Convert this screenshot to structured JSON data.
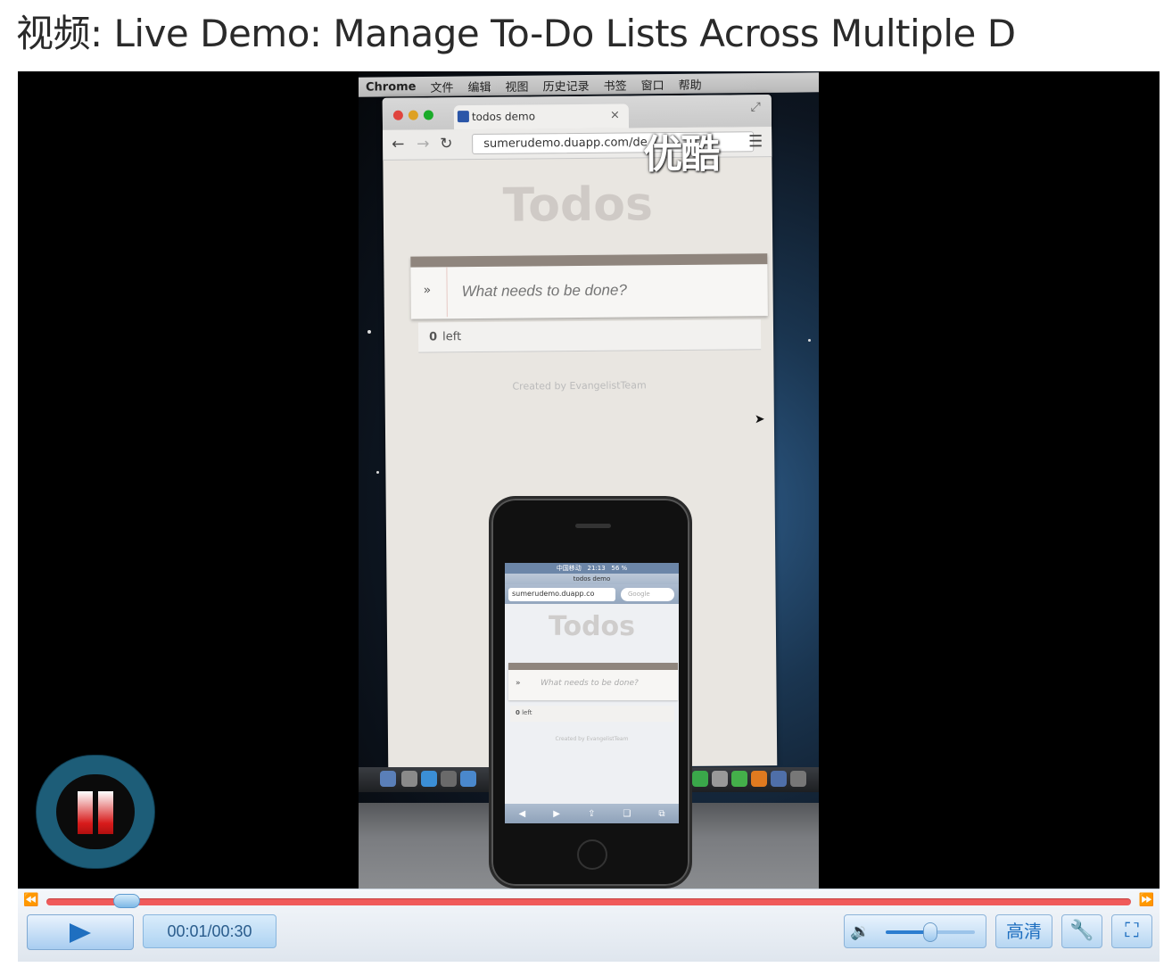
{
  "page": {
    "title": "视频: Live Demo: Manage To-Do Lists Across Multiple D"
  },
  "video": {
    "mac_menubar": [
      "Chrome",
      "文件",
      "编辑",
      "视图",
      "历史记录",
      "书签",
      "窗口",
      "帮助"
    ],
    "browser": {
      "tab_title": "todos demo",
      "tab_close": "×",
      "url": "sumerudemo.duapp.com/de",
      "watermark": "优酷"
    },
    "todos_app": {
      "title": "Todos",
      "toggle_all": "»",
      "input_placeholder": "What needs to be done?",
      "count": "0",
      "count_label": "left",
      "credit": "Created by EvangelistTeam"
    },
    "iphone": {
      "status_time": "21:13",
      "status_carrier": "中国移动",
      "status_battery": "56 %",
      "page_title": "todos demo",
      "url": "sumerudemo.duapp.co",
      "search_placeholder": "Google",
      "todos_title": "Todos",
      "toggle_all": "»",
      "input_placeholder": "What needs to be done?",
      "count": "0",
      "count_label": "left",
      "credit": "Created by EvangelistTeam"
    }
  },
  "player": {
    "state": "paused",
    "time_display": "00:01/00:30",
    "progress": 0.033,
    "volume": 0.5,
    "hd_label": "高清",
    "colors": {
      "progress": "#f05a5a",
      "accent": "#1f6fc0",
      "pause_ring": "#1d5d78"
    }
  }
}
